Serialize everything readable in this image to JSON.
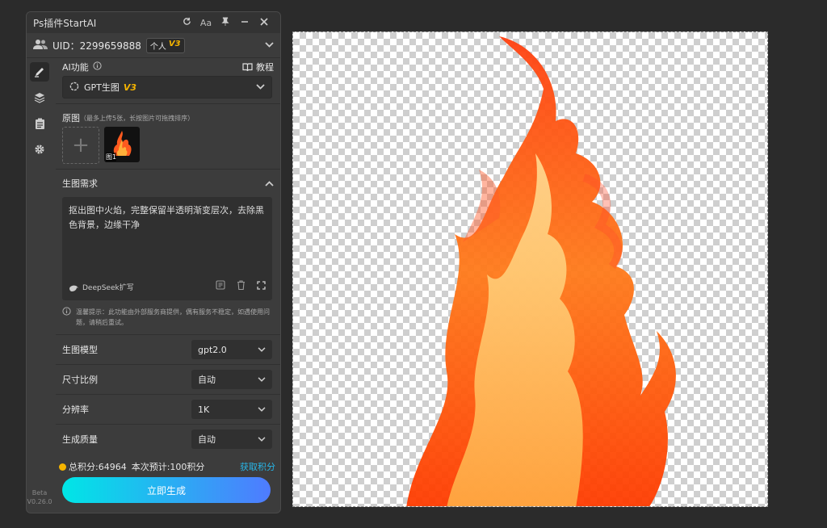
{
  "window": {
    "title": "Ps插件StartAI"
  },
  "titlebar_buttons": [
    "refresh-icon",
    "font-icon",
    "pin-icon",
    "minimize-icon",
    "close-icon"
  ],
  "font_btn_label": "Aa",
  "account": {
    "uid": "UID：2299659888",
    "plan": "个人",
    "plan_version": "V3"
  },
  "ai_section": {
    "label": "AI功能",
    "tutorial": "教程",
    "feature": "GPT生图",
    "feature_version": "V3"
  },
  "original": {
    "label": "原图",
    "hint": "（最多上传5张，长按图片可拖拽排序）",
    "thumb_badge": "图1"
  },
  "prompt": {
    "label": "生图需求",
    "text": "抠出图中火焰，完整保留半透明渐变层次，去除黑色背景，边缘干净",
    "expand_label": "DeepSeek扩写"
  },
  "tip": "温馨提示：此功能由外部服务商提供，偶有服务不稳定，如遇使用问题，请稍后重试。",
  "settings": [
    {
      "label": "生图模型",
      "value": "gpt2.0"
    },
    {
      "label": "尺寸比例",
      "value": "自动"
    },
    {
      "label": "分辨率",
      "value": "1K"
    },
    {
      "label": "生成质量",
      "value": "自动"
    }
  ],
  "credits": {
    "total": "总积分:64964",
    "estimate": "本次预计:100积分",
    "get": "获取积分"
  },
  "generate_button": "立即生成",
  "version": {
    "stage": "Beta",
    "number": "V0.26.0"
  },
  "colors": {
    "accent_yellow": "#f5b400",
    "link_blue": "#27b6e8",
    "gradient_start": "#00e6e6",
    "gradient_end": "#4f7bff"
  }
}
